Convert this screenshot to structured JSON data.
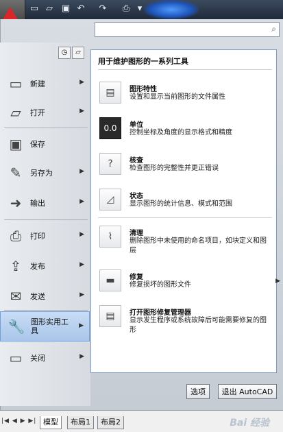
{
  "toolbar": {
    "icons": [
      "new-file-icon",
      "open-folder-icon",
      "save-icon",
      "undo-icon",
      "redo-icon",
      "plot-icon"
    ]
  },
  "left_menu": {
    "items": [
      {
        "label": "新建",
        "icon": "new-icon",
        "has_arrow": true
      },
      {
        "label": "打开",
        "icon": "open-icon",
        "has_arrow": true
      },
      {
        "label": "保存",
        "icon": "save-icon",
        "has_arrow": false
      },
      {
        "label": "另存为",
        "icon": "save-as-icon",
        "has_arrow": true
      },
      {
        "label": "输出",
        "icon": "export-icon",
        "has_arrow": true
      },
      {
        "label": "打印",
        "icon": "print-icon",
        "has_arrow": true
      },
      {
        "label": "发布",
        "icon": "publish-icon",
        "has_arrow": true
      },
      {
        "label": "发送",
        "icon": "send-icon",
        "has_arrow": true
      },
      {
        "label": "图形实用工具",
        "icon": "drawing-utilities-icon",
        "has_arrow": true,
        "selected": true
      },
      {
        "label": "关闭",
        "icon": "close-icon",
        "has_arrow": true
      }
    ]
  },
  "submenu": {
    "title": "用于维护图形的一系列工具",
    "items": [
      {
        "title": "图形特性",
        "desc": "设置和显示当前图形的文件属性",
        "icon": "drawing-properties-icon"
      },
      {
        "title": "单位",
        "desc": "控制坐标及角度的显示格式和精度",
        "icon": "units-icon",
        "icon_text": "0.0"
      },
      {
        "title": "核查",
        "desc": "检查图形的完整性并更正错误",
        "icon": "audit-icon"
      },
      {
        "title": "状态",
        "desc": "显示图形的统计信息、模式和范围",
        "icon": "status-icon"
      },
      {
        "title": "清理",
        "desc": "删除图形中未使用的命名项目，如块定义和图层",
        "icon": "purge-icon"
      },
      {
        "title": "修复",
        "desc": "修复损坏的图形文件",
        "icon": "recover-icon"
      },
      {
        "title": "打开图形修复管理器",
        "desc": "显示发生程序或系统故障后可能需要修复的图形",
        "icon": "recovery-manager-icon"
      }
    ]
  },
  "buttons": {
    "options": "选项",
    "exit": "退出 AutoCAD"
  },
  "tabs": [
    "模型",
    "布局1",
    "布局2"
  ],
  "watermark": "Bai 经验"
}
